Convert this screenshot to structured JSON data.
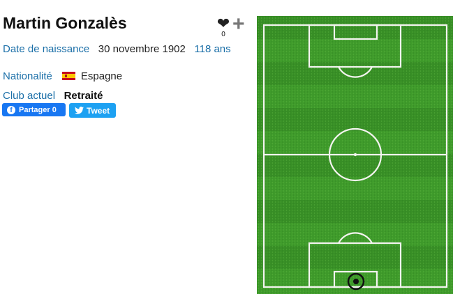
{
  "player": {
    "name": "Martin Gonzalès",
    "birth_label": "Date de naissance",
    "birth_date": "30 novembre 1902",
    "age": "118 ans",
    "nationality_label": "Nationalité",
    "nationality": "Espagne",
    "club_label": "Club actuel",
    "club": "Retraité"
  },
  "share": {
    "facebook_label": "Partager 0",
    "twitter_label": "Tweet"
  },
  "favorite": {
    "count": "0"
  },
  "colors": {
    "link": "#1b6fa8",
    "facebook": "#1877f2",
    "twitter": "#1da1f2",
    "pitch": "#3f9b2b"
  }
}
